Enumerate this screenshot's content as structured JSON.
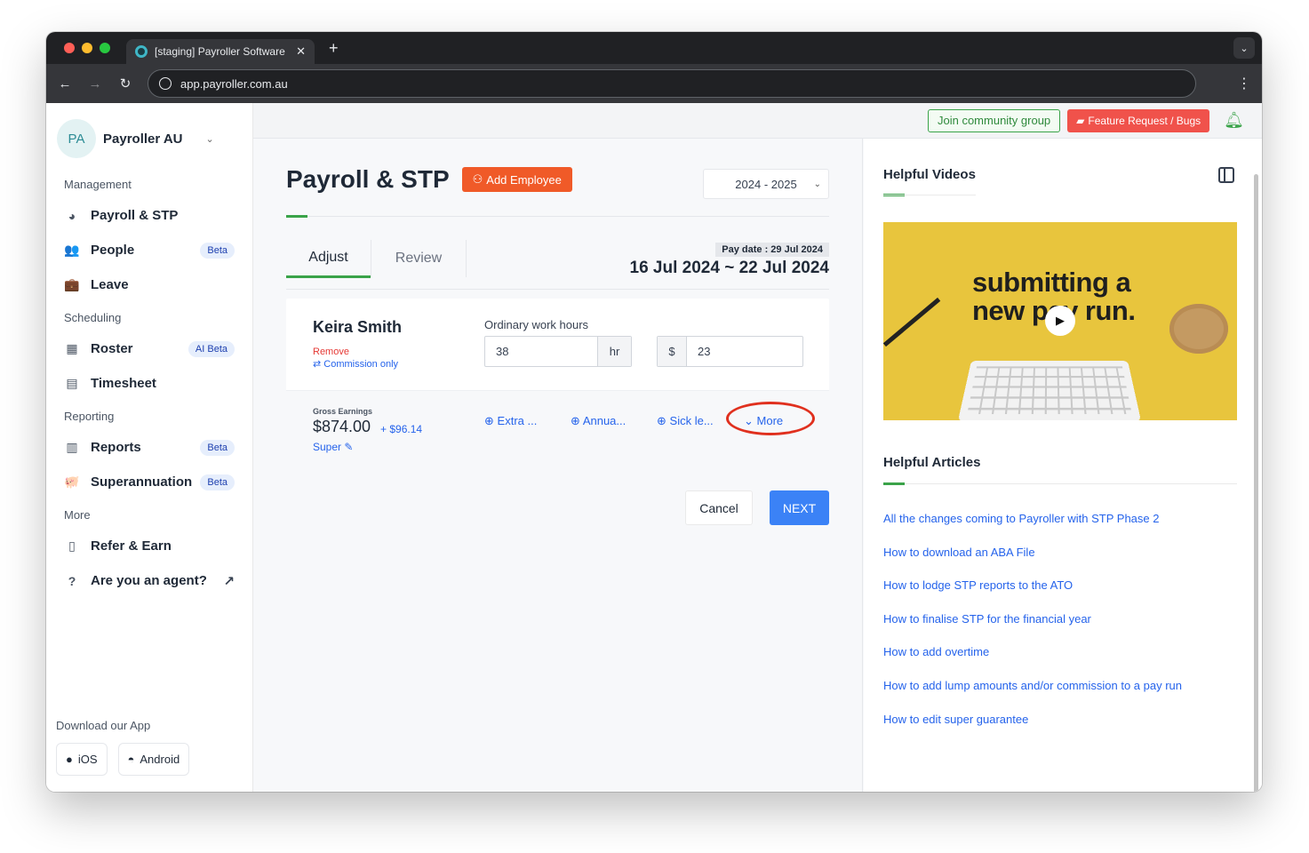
{
  "browser": {
    "tab_title": "[staging] Payroller Software",
    "url": "app.payroller.com.au",
    "new_tab": "+",
    "tab_close": "✕"
  },
  "sidebar": {
    "org_initials": "PA",
    "org_name": "Payroller AU",
    "sections": {
      "management": "Management",
      "scheduling": "Scheduling",
      "reporting": "Reporting",
      "more": "More"
    },
    "items": {
      "payroll": {
        "label": "Payroll & STP",
        "icon": "payroll-icon"
      },
      "people": {
        "label": "People",
        "badge": "Beta",
        "icon": "people-icon"
      },
      "leave": {
        "label": "Leave",
        "icon": "briefcase-icon"
      },
      "roster": {
        "label": "Roster",
        "badge": "AI Beta",
        "icon": "calendar-icon"
      },
      "timesheet": {
        "label": "Timesheet",
        "icon": "timesheet-icon"
      },
      "reports": {
        "label": "Reports",
        "badge": "Beta",
        "icon": "report-icon"
      },
      "super": {
        "label": "Superannuation",
        "badge": "Beta",
        "icon": "piggybank-icon"
      },
      "refer": {
        "label": "Refer & Earn",
        "icon": "document-icon"
      },
      "agent": {
        "label": "Are you an agent?",
        "icon": "question-icon"
      }
    },
    "download_label": "Download our App",
    "ios_label": "iOS",
    "android_label": "Android"
  },
  "topbar": {
    "community": "Join community group",
    "feature": "Feature Request / Bugs"
  },
  "main": {
    "title": "Payroll & STP",
    "add_employee": "Add Employee",
    "year": "2024 - 2025",
    "tabs": {
      "adjust": "Adjust",
      "review": "Review"
    },
    "pay_date": "Pay date : 29 Jul 2024",
    "pay_range": "16 Jul 2024 ~ 22 Jul 2024",
    "employee": {
      "name": "Keira Smith",
      "remove": "Remove",
      "commission": "Commission only",
      "hours_label": "Ordinary work hours",
      "hours": "38",
      "hours_unit": "hr",
      "rate_unit": "$",
      "rate": "23",
      "gross_label": "Gross Earnings",
      "gross_value": "$874.00",
      "gross_extra": "+ $96.14",
      "super": "Super",
      "actions": {
        "extra": "Extra ...",
        "annual": "Annua...",
        "sick": "Sick le...",
        "more": "More"
      }
    },
    "cancel": "Cancel",
    "next": "NEXT"
  },
  "right_panel": {
    "videos_title": "Helpful Videos",
    "video_caption_line1": "submitting a",
    "video_caption_line2": "new pay run.",
    "articles_title": "Helpful Articles",
    "articles": [
      "All the changes coming to Payroller with STP Phase 2",
      "How to download an ABA File",
      "How to lodge STP reports to the ATO",
      "How to finalise STP for the financial year",
      "How to add overtime",
      "How to add lump amounts and/or commission to a pay run",
      "How to edit super guarantee"
    ]
  }
}
